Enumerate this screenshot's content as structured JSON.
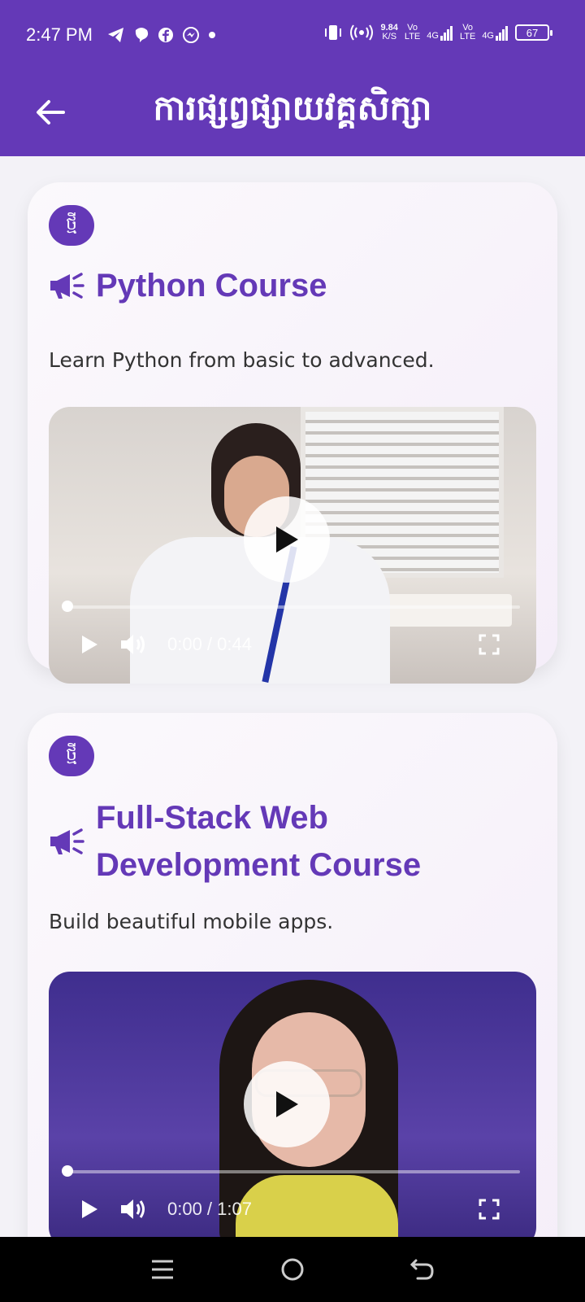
{
  "status_bar": {
    "time": "2:47 PM",
    "net_speed_value": "9.84",
    "net_speed_unit": "K/S",
    "sim1_tag": "Vo\nLTE",
    "sim1_gen": "4G",
    "sim2_tag": "Vo\nLTE",
    "sim2_gen": "4G",
    "battery": "67"
  },
  "app_bar": {
    "title": "ការផ្សព្វផ្សាយវគ្គសិក្សា",
    "back_icon": "arrow-left-icon"
  },
  "courses": [
    {
      "badge": "ថ្មី",
      "title": "Python Course",
      "description": "Learn Python from basic to advanced.",
      "video": {
        "time": "0:00 / 0:44",
        "progress": 0
      }
    },
    {
      "badge": "ថ្មី",
      "title": "Full-Stack Web Development Course",
      "description": "Build beautiful mobile apps.",
      "video": {
        "time": "0:00 / 1:07",
        "progress": 0
      }
    }
  ],
  "colors": {
    "primary": "#6439b7",
    "background": "#f3f2f7",
    "nav_bar": "#000000"
  }
}
